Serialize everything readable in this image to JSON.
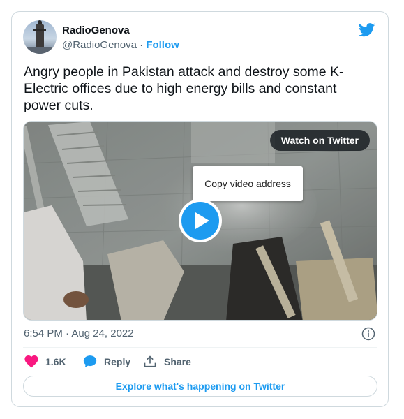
{
  "tweet": {
    "author_name": "RadioGenova",
    "handle": "@RadioGenova",
    "separator": " · ",
    "follow_label": "Follow",
    "text": "Angry people in Pakistan attack and destroy some K-Electric offices due to high energy bills and constant power cuts.",
    "timestamp": "6:54 PM · Aug 24, 2022"
  },
  "media": {
    "watch_label": "Watch on Twitter",
    "context_menu_item": "Copy video address"
  },
  "actions": {
    "like_count": "1.6K",
    "reply_label": "Reply",
    "share_label": "Share"
  },
  "footer": {
    "explore_label": "Explore what's happening on Twitter"
  },
  "icons": {
    "brand": "twitter-bird-icon",
    "like": "heart-icon",
    "reply": "speech-bubble-icon",
    "share": "share-upload-icon",
    "info": "info-icon",
    "play": "play-icon"
  },
  "colors": {
    "accent": "#1d9bf0",
    "like": "#f91880",
    "muted": "#536471",
    "border": "#cfd9de"
  }
}
